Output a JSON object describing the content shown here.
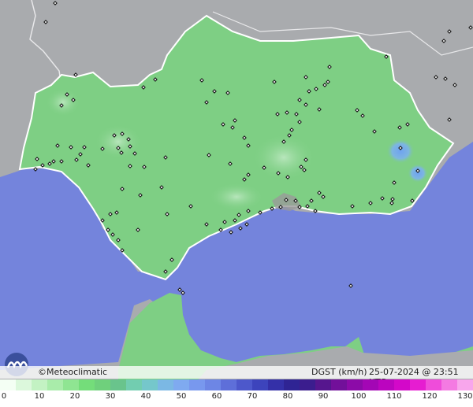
{
  "legend": {
    "brand": "©Meteoclimatic",
    "variable_unit": "DGST (km/h)",
    "timestamp": "25-07-2024 @ 23:51 UTC",
    "ticks": [
      "0",
      "10",
      "20",
      "30",
      "40",
      "50",
      "60",
      "70",
      "80",
      "90",
      "100",
      "110",
      "120",
      "130"
    ],
    "colors": [
      "#f4fff4",
      "#dcf8dc",
      "#c3f2c3",
      "#a9ecaa",
      "#8fe592",
      "#74dd7a",
      "#6fd07c",
      "#69c48c",
      "#72cdb0",
      "#75c7cb",
      "#7bb8e4",
      "#7faaf0",
      "#7898ee",
      "#6d86e5",
      "#5e6fd9",
      "#4d58cb",
      "#3d44bc",
      "#3430a8",
      "#2f2494",
      "#3b1d8e",
      "#56168e",
      "#72109a",
      "#8c0ba8",
      "#a307b5",
      "#bb05bf",
      "#d308c9",
      "#e61dd1",
      "#ef4cda",
      "#f47ae2",
      "#f8a6ec"
    ]
  },
  "map": {
    "sea_color": "#7484dc",
    "land_color": "#7ecf84",
    "outside_color": "#a7a9ac",
    "stations_count_shown": 180
  }
}
